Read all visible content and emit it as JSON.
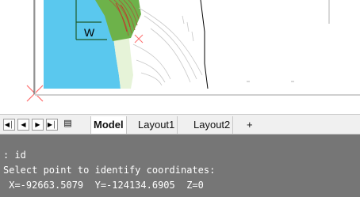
{
  "drawing": {
    "dimension_label": "W",
    "colors": {
      "water": "#5ac8ee",
      "land": "#6db24a",
      "contour": "#9a6b3c",
      "marker": "#ff6b6b",
      "ucs": "#cfcfcf"
    }
  },
  "tabbar": {
    "nav_icons": [
      "first-layout-icon",
      "previous-layout-icon",
      "next-layout-icon",
      "last-layout-icon",
      "layout-menu-icon"
    ],
    "tabs": [
      {
        "label": "Model",
        "active": true
      },
      {
        "label": "Layout1",
        "active": false
      },
      {
        "label": "Layout2",
        "active": false
      }
    ],
    "add_tab_label": "+"
  },
  "command": {
    "lines": [
      ": id",
      "Select point to identify coordinates:",
      " X=-92663.5079  Y=-124134.6905  Z=0"
    ]
  }
}
